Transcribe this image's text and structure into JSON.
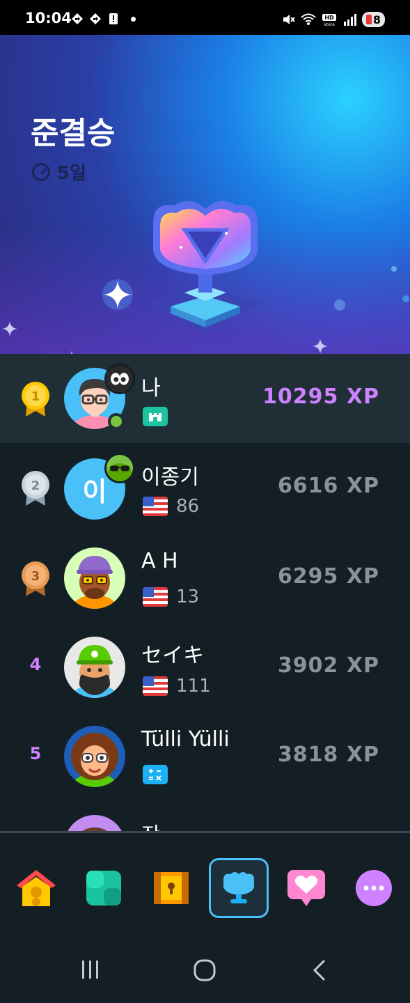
{
  "status_bar": {
    "time": "10:04",
    "battery": "8",
    "icons": [
      "navigation-icon",
      "navigation-icon",
      "alert-icon",
      "dot-icon",
      "mute-icon",
      "wifi-icon",
      "hd-voice-icon",
      "signal-icon"
    ]
  },
  "league": {
    "title": "준결승",
    "days_left": "5일"
  },
  "leaderboard": [
    {
      "rank": "1",
      "name": "나",
      "xp": "10295 XP",
      "sub_value": "",
      "is_me": true,
      "avatar": "glasses-boy"
    },
    {
      "rank": "2",
      "name": "이종기",
      "xp": "6616 XP",
      "sub_value": "86",
      "avatar_letter": "이",
      "avatar": "letter"
    },
    {
      "rank": "3",
      "name": "A H",
      "xp": "6295 XP",
      "sub_value": "13",
      "avatar": "purple-cap"
    },
    {
      "rank": "4",
      "name": "セイキ",
      "xp": "3902 XP",
      "sub_value": "111",
      "avatar": "green-cap"
    },
    {
      "rank": "5",
      "name": "Tülli Yülli",
      "xp": "3818 XP",
      "sub_value": "",
      "avatar": "curly-hair"
    },
    {
      "rank": "",
      "name": "잔",
      "xp": "",
      "sub_value": "",
      "avatar": "partial"
    }
  ],
  "nav": {
    "items": [
      "home-icon",
      "practice-icon",
      "chest-icon",
      "leaderboard-icon",
      "heart-icon",
      "more-icon"
    ],
    "active": "leaderboard-icon"
  },
  "colors": {
    "accent": "#ce82ff",
    "background": "#131f24",
    "row_me": "#202f36",
    "active_nav": "#49c0f8"
  }
}
